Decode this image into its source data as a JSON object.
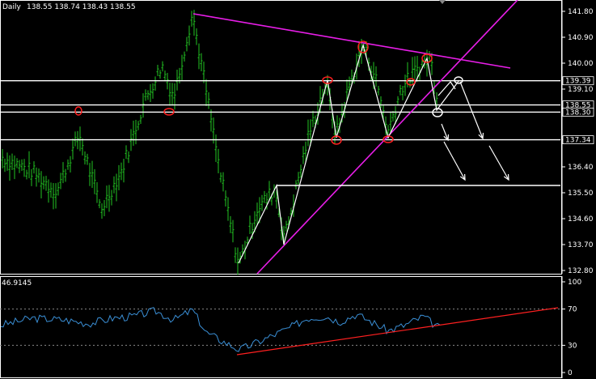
{
  "header": {
    "timeframe": "Daily",
    "ohlc": "138.55 138.74 138.43 138.55"
  },
  "chart_data": [
    {
      "type": "candlestick",
      "ylim": [
        132.5,
        142.2
      ],
      "y_ticks": [
        {
          "value": 141.8,
          "label": "141.80"
        },
        {
          "value": 140.9,
          "label": "140.90"
        },
        {
          "value": 140.0,
          "label": "140.00"
        },
        {
          "value": 139.1,
          "label": "139.10"
        },
        {
          "value": 137.34,
          "label": "137.34"
        },
        {
          "value": 136.4,
          "label": "136.40"
        },
        {
          "value": 135.5,
          "label": "135.50"
        },
        {
          "value": 134.6,
          "label": "134.60"
        },
        {
          "value": 133.7,
          "label": "133.70"
        },
        {
          "value": 132.8,
          "label": "132.80"
        }
      ],
      "level_labels": [
        {
          "value": 139.39,
          "label": "139.39"
        },
        {
          "value": 138.55,
          "label": "138.55"
        },
        {
          "value": 138.3,
          "label": "138.30"
        },
        {
          "value": 137.34,
          "label": "137.34"
        }
      ],
      "horizontal_levels": [
        139.39,
        138.55,
        138.3,
        137.34
      ],
      "bar_color": "#22c422",
      "level_color": "#ffffff",
      "trendline_color": "#e81ee8",
      "marker_color": "#ff2020"
    },
    {
      "type": "line",
      "indicator_value": "46.9145",
      "ylim": [
        0,
        100
      ],
      "y_ticks": [
        {
          "value": 100,
          "label": "100"
        },
        {
          "value": 70,
          "label": "70"
        },
        {
          "value": 30,
          "label": "30"
        },
        {
          "value": 0,
          "label": "0"
        }
      ],
      "levels": [
        70,
        30
      ],
      "line_color": "#3a8fd6",
      "trendline_color": "#ff2020"
    }
  ]
}
